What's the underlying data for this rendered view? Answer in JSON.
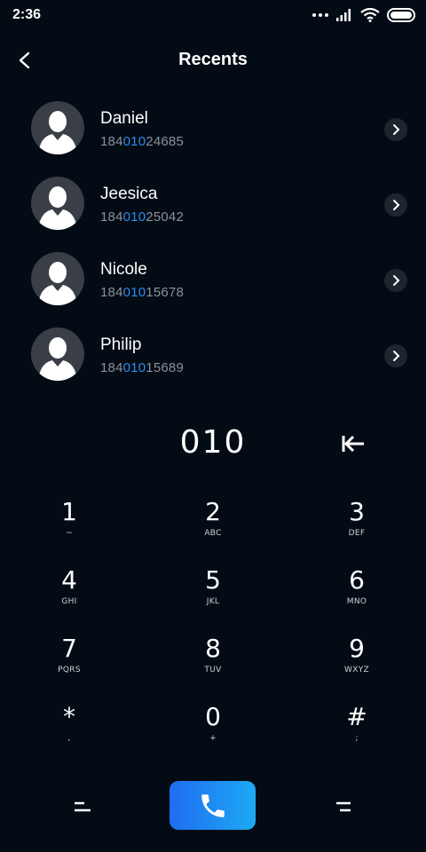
{
  "status_bar": {
    "time": "2:36"
  },
  "header": {
    "title": "Recents"
  },
  "contacts": [
    {
      "name": "Daniel",
      "number_prefix": "184",
      "number_match": "010",
      "number_suffix": "24685"
    },
    {
      "name": "Jeesica",
      "number_prefix": "184",
      "number_match": "010",
      "number_suffix": "25042"
    },
    {
      "name": "Nicole",
      "number_prefix": "184",
      "number_match": "010",
      "number_suffix": "15678"
    },
    {
      "name": "Philip",
      "number_prefix": "184",
      "number_match": "010",
      "number_suffix": "15689"
    }
  ],
  "dialer": {
    "input": "010",
    "keys": [
      {
        "digit": "1",
        "letters": "~"
      },
      {
        "digit": "2",
        "letters": "ABC"
      },
      {
        "digit": "3",
        "letters": "DEF"
      },
      {
        "digit": "4",
        "letters": "GHI"
      },
      {
        "digit": "5",
        "letters": "JKL"
      },
      {
        "digit": "6",
        "letters": "MNO"
      },
      {
        "digit": "7",
        "letters": "PQRS"
      },
      {
        "digit": "8",
        "letters": "TUV"
      },
      {
        "digit": "9",
        "letters": "WXYZ"
      },
      {
        "digit": "*",
        "letters": ","
      },
      {
        "digit": "0",
        "letters": "+"
      },
      {
        "digit": "#",
        "letters": ";"
      }
    ]
  },
  "colors": {
    "background": "#030b14",
    "highlight": "#2e8cf0",
    "call_gradient_start": "#1f6df0",
    "call_gradient_end": "#1ea9f5"
  },
  "icons": {
    "back": "chevron-left-icon",
    "row_action": "chevron-right-icon",
    "backspace": "backspace-arrow-icon",
    "call": "phone-icon",
    "left_action": "menu-lines-icon",
    "right_action": "menu-lines-icon"
  }
}
